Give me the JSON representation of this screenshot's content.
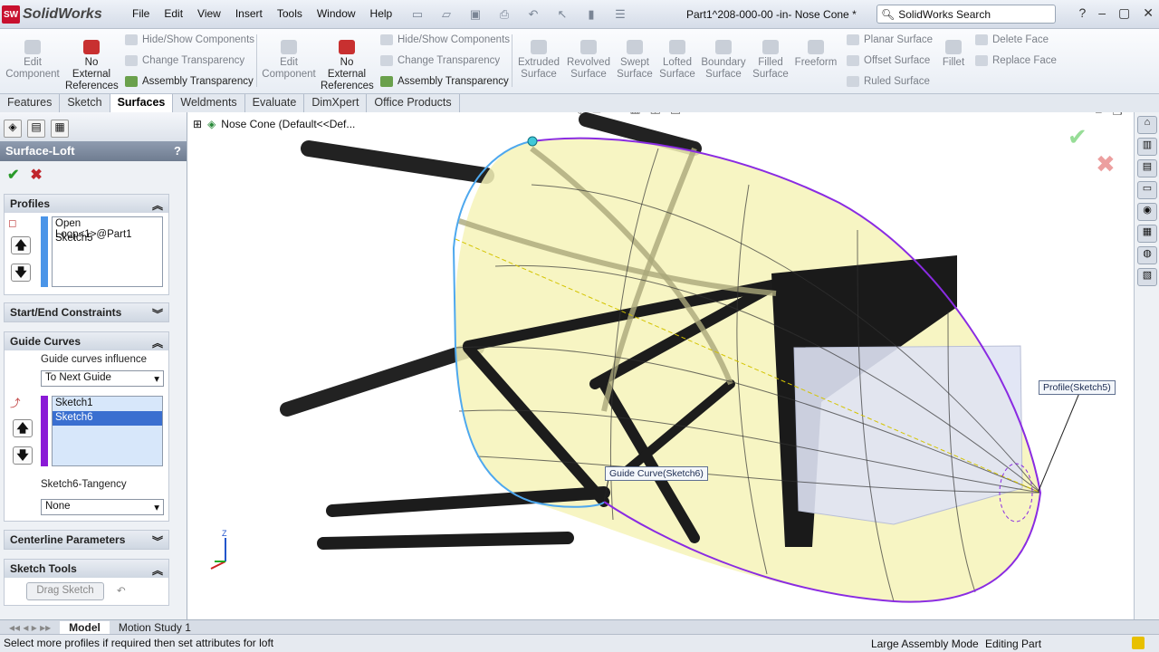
{
  "app": {
    "name": "SolidWorks",
    "document_title": "Part1^208-000-00 -in- Nose Cone *",
    "search_placeholder": "SolidWorks Search"
  },
  "menu": [
    "File",
    "Edit",
    "View",
    "Insert",
    "Tools",
    "Window",
    "Help"
  ],
  "ribbon": {
    "edit_component": "Edit\nComponent",
    "no_external": "No\nExternal\nReferences",
    "hide_show": "Hide/Show Components",
    "change_transparency": "Change Transparency",
    "assembly_transparency": "Assembly Transparency",
    "extruded": "Extruded\nSurface",
    "revolved": "Revolved\nSurface",
    "swept": "Swept\nSurface",
    "lofted": "Lofted\nSurface",
    "boundary": "Boundary\nSurface",
    "filled": "Filled\nSurface",
    "freeform": "Freeform",
    "planar": "Planar Surface",
    "offset": "Offset Surface",
    "ruled": "Ruled Surface",
    "fillet": "Fillet",
    "delete_face": "Delete Face",
    "replace_face": "Replace Face"
  },
  "tabs": [
    "Features",
    "Sketch",
    "Surfaces",
    "Weldments",
    "Evaluate",
    "DimXpert",
    "Office Products"
  ],
  "active_tab": "Surfaces",
  "panel": {
    "title": "Surface-Loft",
    "help": "?",
    "profiles_header": "Profiles",
    "profiles": [
      "Open Loop<1>@Part1",
      "Sketch5"
    ],
    "start_end_header": "Start/End Constraints",
    "guide_header": "Guide Curves",
    "guide_influence_label": "Guide curves influence",
    "guide_influence_value": "To Next Guide",
    "guides": [
      "Sketch1",
      "Sketch6"
    ],
    "tangency_label": "Sketch6-Tangency",
    "tangency_value": "None",
    "centerline_header": "Centerline Parameters",
    "sketch_tools_header": "Sketch Tools",
    "drag_sketch": "Drag Sketch"
  },
  "viewport": {
    "tree_label": "Nose Cone  (Default<<Def...",
    "callout_profile": "Profile(Sketch5)",
    "callout_guide": "Guide Curve(Sketch6)",
    "axis_z": "Z"
  },
  "bottom_tabs": [
    "Model",
    "Motion Study 1"
  ],
  "status": {
    "message": "Select more profiles if required then set attributes for loft",
    "mode": "Large Assembly Mode",
    "editing": "Editing Part"
  }
}
